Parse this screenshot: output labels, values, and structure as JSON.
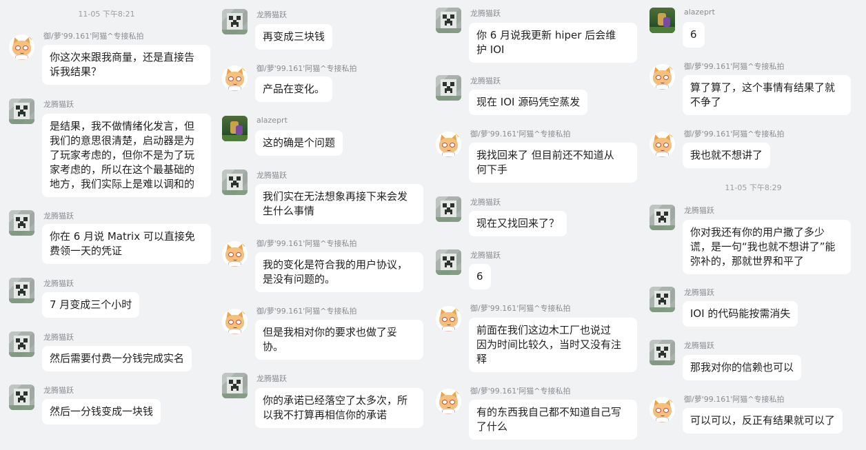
{
  "timestamps": [
    "11-05 下午8:21",
    "11-05 下午8:29"
  ],
  "columns": [
    {
      "messages": [
        {
          "sender": "御/萝'99.161'阿猫^专接私拍",
          "avatar": "cat-avatar-icon",
          "text": "你这次来跟我商量，还是直接告\n诉我结果？"
        },
        {
          "sender": "龙腾猫跃",
          "avatar": "creeper-avatar-icon",
          "text": "是结果，我不做情绪化发言，但\n我们的意思很清楚，启动器是为\n了玩家考虑的，但你不是为了玩\n家考虑的，所以在这个最基础的\n地方，我们实际上是难以调和的"
        },
        {
          "sender": "龙腾猫跃",
          "avatar": "creeper-avatar-icon",
          "text": "你在 6 月说 Matrix 可以直接免\n费领一天的凭证"
        },
        {
          "sender": "龙腾猫跃",
          "avatar": "creeper-avatar-icon",
          "text": "7 月变成三个小时"
        },
        {
          "sender": "龙腾猫跃",
          "avatar": "creeper-avatar-icon",
          "text": "然后需要付费一分钱完成实名"
        },
        {
          "sender": "龙腾猫跃",
          "avatar": "creeper-avatar-icon",
          "text": "然后一分钱变成一块钱"
        }
      ]
    },
    {
      "messages": [
        {
          "sender": "龙腾猫跃",
          "avatar": "creeper-avatar-icon",
          "text": "再变成三块钱"
        },
        {
          "sender": "御/萝'99.161'阿猫^专接私拍",
          "avatar": "cat-avatar-icon",
          "text": "产品在变化。"
        },
        {
          "sender": "alazeprt",
          "avatar": "game-avatar-icon",
          "text": "这的确是个问题"
        },
        {
          "sender": "龙腾猫跃",
          "avatar": "creeper-avatar-icon",
          "text": "我们实在无法想象再接下来会发\n生什么事情"
        },
        {
          "sender": "御/萝'99.161'阿猫^专接私拍",
          "avatar": "cat-avatar-icon",
          "text": "我的变化是符合我的用户协议，\n是没有问题的。"
        },
        {
          "sender": "御/萝'99.161'阿猫^专接私拍",
          "avatar": "cat-avatar-icon",
          "text": "但是我相对你的要求也做了妥\n协。"
        },
        {
          "sender": "龙腾猫跃",
          "avatar": "creeper-avatar-icon",
          "text": "你的承诺已经落空了太多次，所\n以我不打算再相信你的承诺"
        }
      ]
    },
    {
      "messages": [
        {
          "sender": "龙腾猫跃",
          "avatar": "creeper-avatar-icon",
          "text": "你 6 月说我更新 hiper 后会维\n护 IOI"
        },
        {
          "sender": "龙腾猫跃",
          "avatar": "creeper-avatar-icon",
          "text": "现在 IOI 源码凭空蒸发"
        },
        {
          "sender": "御/萝'99.161'阿猫^专接私拍",
          "avatar": "cat-avatar-icon",
          "text": "我找回来了 但目前还不知道从\n何下手"
        },
        {
          "sender": "龙腾猫跃",
          "avatar": "creeper-avatar-icon",
          "text": "现在又找回来了？"
        },
        {
          "sender": "龙腾猫跃",
          "avatar": "creeper-avatar-icon",
          "text": "6"
        },
        {
          "sender": "御/萝'99.161'阿猫^专接私拍",
          "avatar": "cat-avatar-icon",
          "text": "前面在我们这边木工厂也说过\n因为时间比较久，当时又没有注\n释"
        },
        {
          "sender": "御/萝'99.161'阿猫^专接私拍",
          "avatar": "cat-avatar-icon",
          "text": "有的东西我自己都不知道自己写\n了什么"
        }
      ]
    },
    {
      "messages": [
        {
          "sender": "alazeprt",
          "avatar": "game-avatar-icon",
          "text": "6"
        },
        {
          "sender": "御/萝'99.161'阿猫^专接私拍",
          "avatar": "cat-avatar-icon",
          "text": "算了算了，这个事情有结果了就\n不争了"
        },
        {
          "sender": "御/萝'99.161'阿猫^专接私拍",
          "avatar": "cat-avatar-icon",
          "text": "我也就不想讲了"
        },
        {
          "sender": "龙腾猫跃",
          "avatar": "creeper-avatar-icon",
          "text": "你对我还有你的用户撒了多少\n谎，是一句“我也就不想讲了”能\n弥补的，那就世界和平了"
        },
        {
          "sender": "龙腾猫跃",
          "avatar": "creeper-avatar-icon",
          "text": "IOI 的代码能按需消失"
        },
        {
          "sender": "龙腾猫跃",
          "avatar": "creeper-avatar-icon",
          "text": "那我对你的信赖也可以"
        },
        {
          "sender": "御/萝'99.161'阿猫^专接私拍",
          "avatar": "cat-avatar-icon",
          "text": "可以可以，反正有结果就可以了"
        }
      ]
    }
  ]
}
